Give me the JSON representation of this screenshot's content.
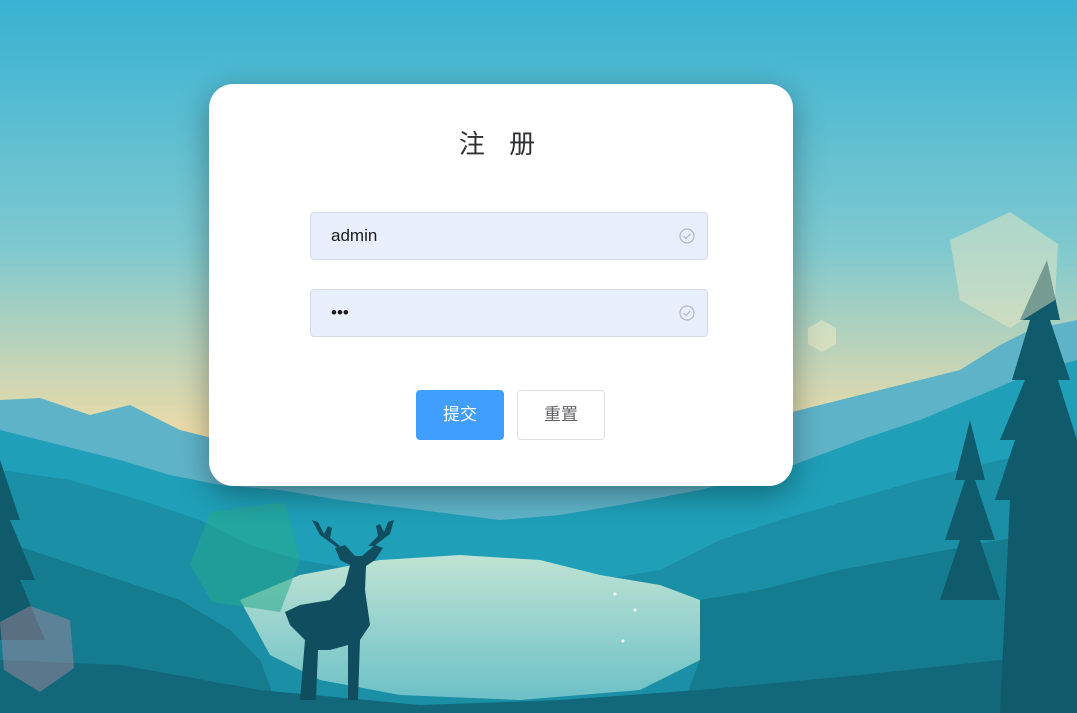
{
  "form": {
    "title": "注 册",
    "username": {
      "value": "admin"
    },
    "password": {
      "value": "abc"
    },
    "submit_label": "提交",
    "reset_label": "重置"
  },
  "colors": {
    "primary": "#409eff",
    "input_bg": "#e8eefb",
    "sky_top": "#38b2d3",
    "sky_horizon": "#f2dca6"
  },
  "icons": {
    "username_status": "circle-check-icon",
    "password_status": "circle-check-icon"
  }
}
